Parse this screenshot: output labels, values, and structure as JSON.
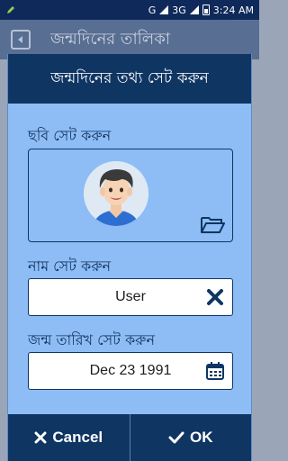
{
  "status_bar": {
    "time": "3:24 AM",
    "network": "G",
    "network2": "3G"
  },
  "app_bar": {
    "title": "জন্মদিনের তালিকা"
  },
  "dialog": {
    "title": "জন্মদিনের তথ্য সেট করুন",
    "photo_label": "ছবি সেট করুন",
    "name_label": "নাম সেট করুন",
    "name_value": "User",
    "dob_label": "জন্ম তারিখ সেট করুন",
    "dob_value": "Dec 23 1991",
    "cancel_label": "Cancel",
    "ok_label": "OK"
  },
  "colors": {
    "primary": "#0f3563",
    "dialog_bg": "#8dbdf4",
    "field_bg": "#ffffff"
  },
  "icons": {
    "back": "back-arrow-icon",
    "folder": "folder-open-icon",
    "clear": "close-icon",
    "calendar": "calendar-icon",
    "cancel": "close-icon",
    "ok": "check-icon"
  }
}
